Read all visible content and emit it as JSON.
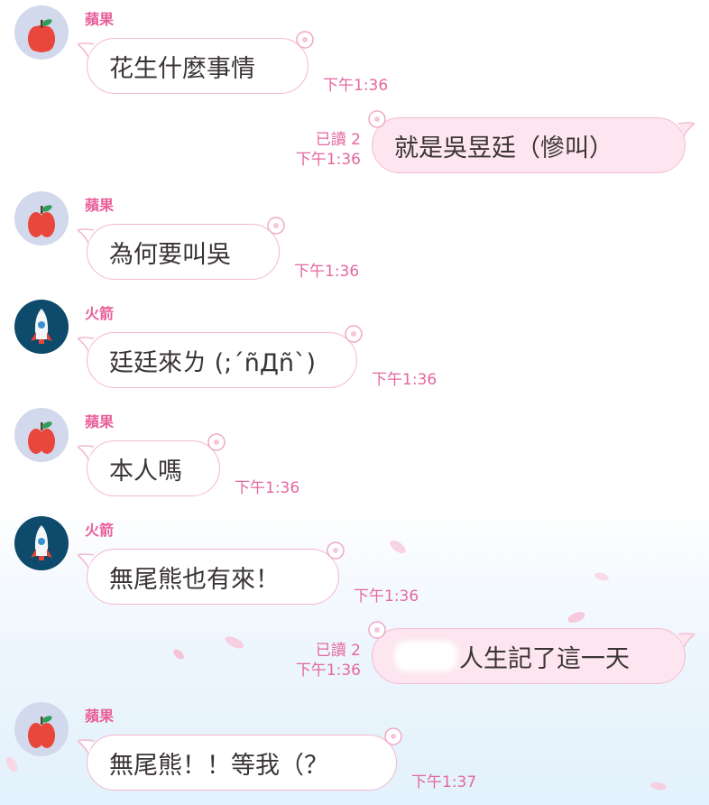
{
  "messages": [
    {
      "sender": "蘋果",
      "text": "花生什麼事情",
      "time": "下午1:36"
    },
    {
      "read": "已讀 2",
      "time": "下午1:36",
      "text": "就是吳昱廷（慘叫）"
    },
    {
      "sender": "蘋果",
      "text": "為何要叫吳",
      "time": "下午1:36"
    },
    {
      "sender": "火箭",
      "text": "廷廷來ㄌ (;´ñДñ`)",
      "time": "下午1:36"
    },
    {
      "sender": "蘋果",
      "text": "本人嗎",
      "time": "下午1:36"
    },
    {
      "sender": "火箭",
      "text": "無尾熊也有來！",
      "time": "下午1:36"
    },
    {
      "read": "已讀 2",
      "time": "下午1:36",
      "text": "人生記了這一天"
    },
    {
      "sender": "蘋果",
      "text": "無尾熊！！等我（？",
      "time": "下午1:37"
    }
  ],
  "avatars": {
    "apple": "apple-icon",
    "rocket": "rocket-icon"
  },
  "colors": {
    "accent": "#e8609a",
    "bubble_border": "#f3b7cf",
    "out_bubble": "#fde6ef"
  }
}
